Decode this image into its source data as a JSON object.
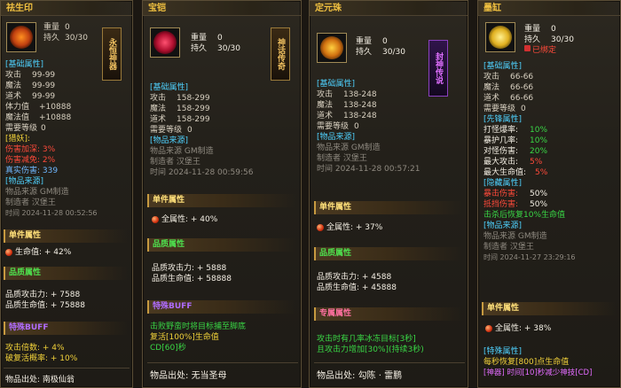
{
  "panels": [
    {
      "title": "祛生印",
      "title_color": "#f0c040",
      "weight_label": "重量",
      "weight": "0",
      "durability_label": "持久",
      "durability": "30/30",
      "tag_text": "永恒神器",
      "base_header": "[基础属性]",
      "stats": [
        {
          "label": "攻击",
          "value": "99-99"
        },
        {
          "label": "魔法",
          "value": "99-99"
        },
        {
          "label": "道术",
          "value": "99-99"
        },
        {
          "label": "体力值",
          "value": "+10888"
        },
        {
          "label": "魔法值",
          "value": "+10888"
        },
        {
          "label": "需要等级",
          "value": "0"
        }
      ],
      "special_header": "[猎妖]:",
      "special_lines": [
        "伤害加深: 3%",
        "伤害减免: 2%"
      ],
      "true_damage": "真实伤害: 339",
      "source_header": "[物品来源]",
      "source_lines": [
        "物品来源  GM制造",
        "制造者    汉堡王",
        "时间  2024-11-28 00:52:56"
      ],
      "single_header": "单件属性",
      "single_line": "生命值: + 42%",
      "quality_header": "品质属性",
      "quality_lines": [
        "品质攻击力: + 7588",
        "品质生命值: + 75888"
      ],
      "buff_header": "特殊BUFF",
      "buff_lines": [
        "攻击倍数: + 4%",
        "破复活概率: + 10%"
      ],
      "origin": "物品出处: 南极仙翁"
    },
    {
      "title": "宝铠",
      "title_color": "#f0c040",
      "weight_label": "重量",
      "weight": "0",
      "durability_label": "持久",
      "durability": "30/30",
      "tag_text": "神话传奇",
      "base_header": "[基础属性]",
      "stats": [
        {
          "label": "攻击",
          "value": "158-299"
        },
        {
          "label": "魔法",
          "value": "158-299"
        },
        {
          "label": "道术",
          "value": "158-299"
        },
        {
          "label": "需要等级",
          "value": "0"
        }
      ],
      "source_header": "[物品来源]",
      "source_lines": [
        "物品来源  GM制造",
        "制造者    汉堡王",
        "时间  2024-11-28 00:59:56"
      ],
      "single_header": "单件属性",
      "single_line": "全属性: + 40%",
      "quality_header": "品质属性",
      "quality_lines": [
        "品质攻击力: + 5888",
        "品质生命值: + 58888"
      ],
      "buff_header": "特殊BUFF",
      "buff_lines": [
        "击败野蛮时将目标捕至脚底",
        "复活[100%]生命值",
        "CD[60]秒"
      ],
      "origin_label": "物品出处:",
      "origin_value": "无当圣母"
    },
    {
      "title": "定元珠",
      "title_color": "#f0c040",
      "weight_label": "重量",
      "weight": "0",
      "durability_label": "持久",
      "durability": "30/30",
      "tag_text": "封神传说",
      "base_header": "[基础属性]",
      "stats": [
        {
          "label": "攻击",
          "value": "138-248"
        },
        {
          "label": "魔法",
          "value": "138-248"
        },
        {
          "label": "道术",
          "value": "138-248"
        },
        {
          "label": "需要等级",
          "value": "0"
        }
      ],
      "source_header": "[物品来源]",
      "source_lines": [
        "物品来源  GM制造",
        "制造者    汉堡王",
        "时间  2024-11-28 00:57:21"
      ],
      "single_header": "单件属性",
      "single_line": "全属性: + 37%",
      "quality_header": "品质属性",
      "quality_lines": [
        "品质攻击力: + 4588",
        "品质生命值: + 45888"
      ],
      "excl_header": "专属属性",
      "excl_lines": [
        "攻击时有几率冰冻目标[3秒]",
        "且攻击力增加[30%](持续3秒)"
      ],
      "origin_label": "物品出处:",
      "origin_value": "勾陈 · 雷鹏"
    },
    {
      "title": "墨缸",
      "title_color": "#f0c040",
      "weight_label": "重量",
      "weight": "0",
      "durability_label": "持久",
      "durability": "30/30",
      "bound": "已绑定",
      "base_header": "[基础属性]",
      "stats": [
        {
          "label": "攻击",
          "value": "66-66"
        },
        {
          "label": "魔法",
          "value": "66-66"
        },
        {
          "label": "道术",
          "value": "66-66"
        },
        {
          "label": "需要等级",
          "value": "0"
        }
      ],
      "lead_header": "[先锋属性]",
      "lead_lines": [
        {
          "label": "打怪爆率:",
          "value": "10%"
        },
        {
          "label": "暴护几率:",
          "value": "10%"
        },
        {
          "label": "对怪伤害:",
          "value": "20%"
        },
        {
          "label": "最大攻击:",
          "value": "5%"
        },
        {
          "label": "最大生命值:",
          "value": "5%"
        }
      ],
      "hidden_header": "[隐藏属性]",
      "hidden_lines": [
        {
          "label": "暴击伤害:",
          "value": "50%"
        },
        {
          "label": "抵挡伤害:",
          "value": "50%"
        },
        {
          "label": "击杀后恢复10%生命值",
          "value": ""
        }
      ],
      "source_header": "[物品来源]",
      "source_lines": [
        "物品来源  GM制造",
        "制造者    汉堡王",
        "时间  2024-11-27 23:29:16"
      ],
      "single_header": "单件属性",
      "single_line": "全属性: + 38%",
      "special_header": "[特殊属性]",
      "special_lines": [
        "每秒恢复[800]点生命值",
        "[神器]  时间[10]秒减少神技[CD]"
      ]
    }
  ]
}
